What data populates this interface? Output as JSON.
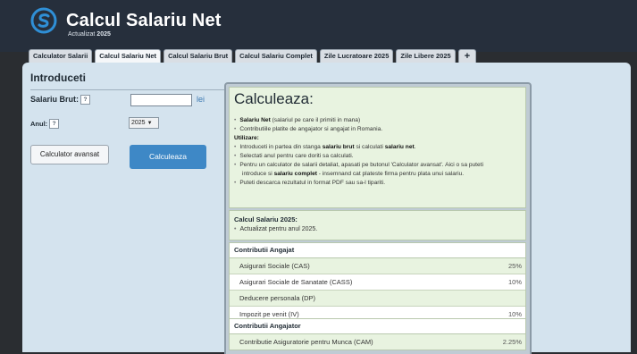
{
  "header": {
    "title": "Calcul Salariu Net",
    "subtitle_prefix": "Actualizat ",
    "subtitle_year": "2025"
  },
  "tabs": [
    {
      "label": "Calculator Salarii",
      "active": false
    },
    {
      "label": "Calcul Salariu Net",
      "active": true
    },
    {
      "label": "Calcul Salariu Brut",
      "active": false
    },
    {
      "label": "Calcul Salariu Complet",
      "active": false
    },
    {
      "label": "Zile Lucratoare 2025",
      "active": false
    },
    {
      "label": "Zile Libere 2025",
      "active": false
    },
    {
      "label": "+",
      "active": false
    }
  ],
  "form": {
    "title": "Introduceti",
    "salary_label": "Salariu Brut:",
    "help_mark": "?",
    "salary_value": "",
    "salary_unit": "lei",
    "year_label": "Anul:",
    "year_selected": "2025",
    "advanced_button": "Calculator avansat",
    "calculate_button": "Calculeaza"
  },
  "info": {
    "title": "Calculeaza:",
    "line1_b": "Salariu Net",
    "line1_rest": " (salariul pe care il primiti in mana)",
    "line2": "Contributiile platite de angajator si angajat in Romania.",
    "usage_label": "Utilizare:",
    "line3_a": "Introduceti in partea din stanga ",
    "line3_b1": "salariu brut",
    "line3_c": " si calculati ",
    "line3_b2": "salariu net",
    "line3_d": ".",
    "line4": "Selectati anul pentru care doriti sa calculati.",
    "line5": "Pentru un calculator de salarii detaliat, apasati pe butonul 'Calculator avansat'. Aici o sa puteti",
    "line5b_a": "introduce si ",
    "line5b_b": "salariu complet",
    "line5b_c": " - insemnand cat plateste firma pentru plata unui salariu.",
    "line6": "Puteti descarca rezultatul in format PDF sau sa-l tipariti."
  },
  "update_box": {
    "title": "Calcul Salariu 2025:",
    "text": "Actualizat pentru anul 2025."
  },
  "employee_contrib": {
    "title": "Contributii Angajat",
    "rows": [
      {
        "name": "Asigurari Sociale (CAS)",
        "value": "25%"
      },
      {
        "name": "Asigurari Sociale de Sanatate (CASS)",
        "value": "10%"
      },
      {
        "name": "Deducere personala (DP)",
        "value": ""
      },
      {
        "name": "Impozit pe venit (IV)",
        "value": "10%"
      }
    ]
  },
  "employer_contrib": {
    "title": "Contributii Angajator",
    "rows": [
      {
        "name": "Contributie Asiguratorie pentru Munca (CAM)",
        "value": "2.25%"
      }
    ]
  },
  "colors": {
    "header_bg": "#262f3c",
    "content_bg": "#d4e3ee",
    "accent_blue": "#3e88c6",
    "info_green": "#e8f3e0"
  },
  "icons": {
    "logo": "s-logo-icon",
    "dropdown": "chevron-down-icon"
  }
}
